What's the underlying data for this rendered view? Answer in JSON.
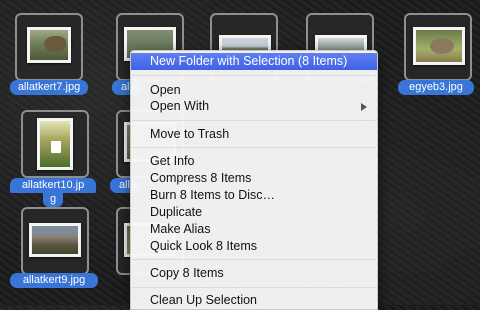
{
  "desktop": {
    "icons": [
      {
        "label": "allatkert7.jpg"
      },
      {
        "label": "alla"
      },
      {
        "label": "egyeb3.jpg"
      },
      {
        "label_line1": "allatkert10.jp",
        "label_line2": "g"
      },
      {
        "label": "alla"
      },
      {
        "label": "allatkert9.jpg"
      }
    ]
  },
  "context_menu": {
    "items": [
      {
        "label": "New Folder with Selection (8 Items)",
        "highlighted": true
      },
      {
        "label": "Open"
      },
      {
        "label": "Open With",
        "submenu_icon": "triangle-right-icon"
      },
      {
        "label": "Move to Trash"
      },
      {
        "label": "Get Info"
      },
      {
        "label": "Compress 8 Items"
      },
      {
        "label": "Burn 8 Items to Disc…"
      },
      {
        "label": "Duplicate"
      },
      {
        "label": "Make Alias"
      },
      {
        "label": "Quick Look 8 Items"
      },
      {
        "label": "Copy 8 Items"
      },
      {
        "label": "Clean Up Selection"
      }
    ],
    "highlight_color": "#4a6ee9"
  },
  "colors": {
    "selection_label": "#3875d7",
    "menu_background": "#f6f6f6"
  }
}
